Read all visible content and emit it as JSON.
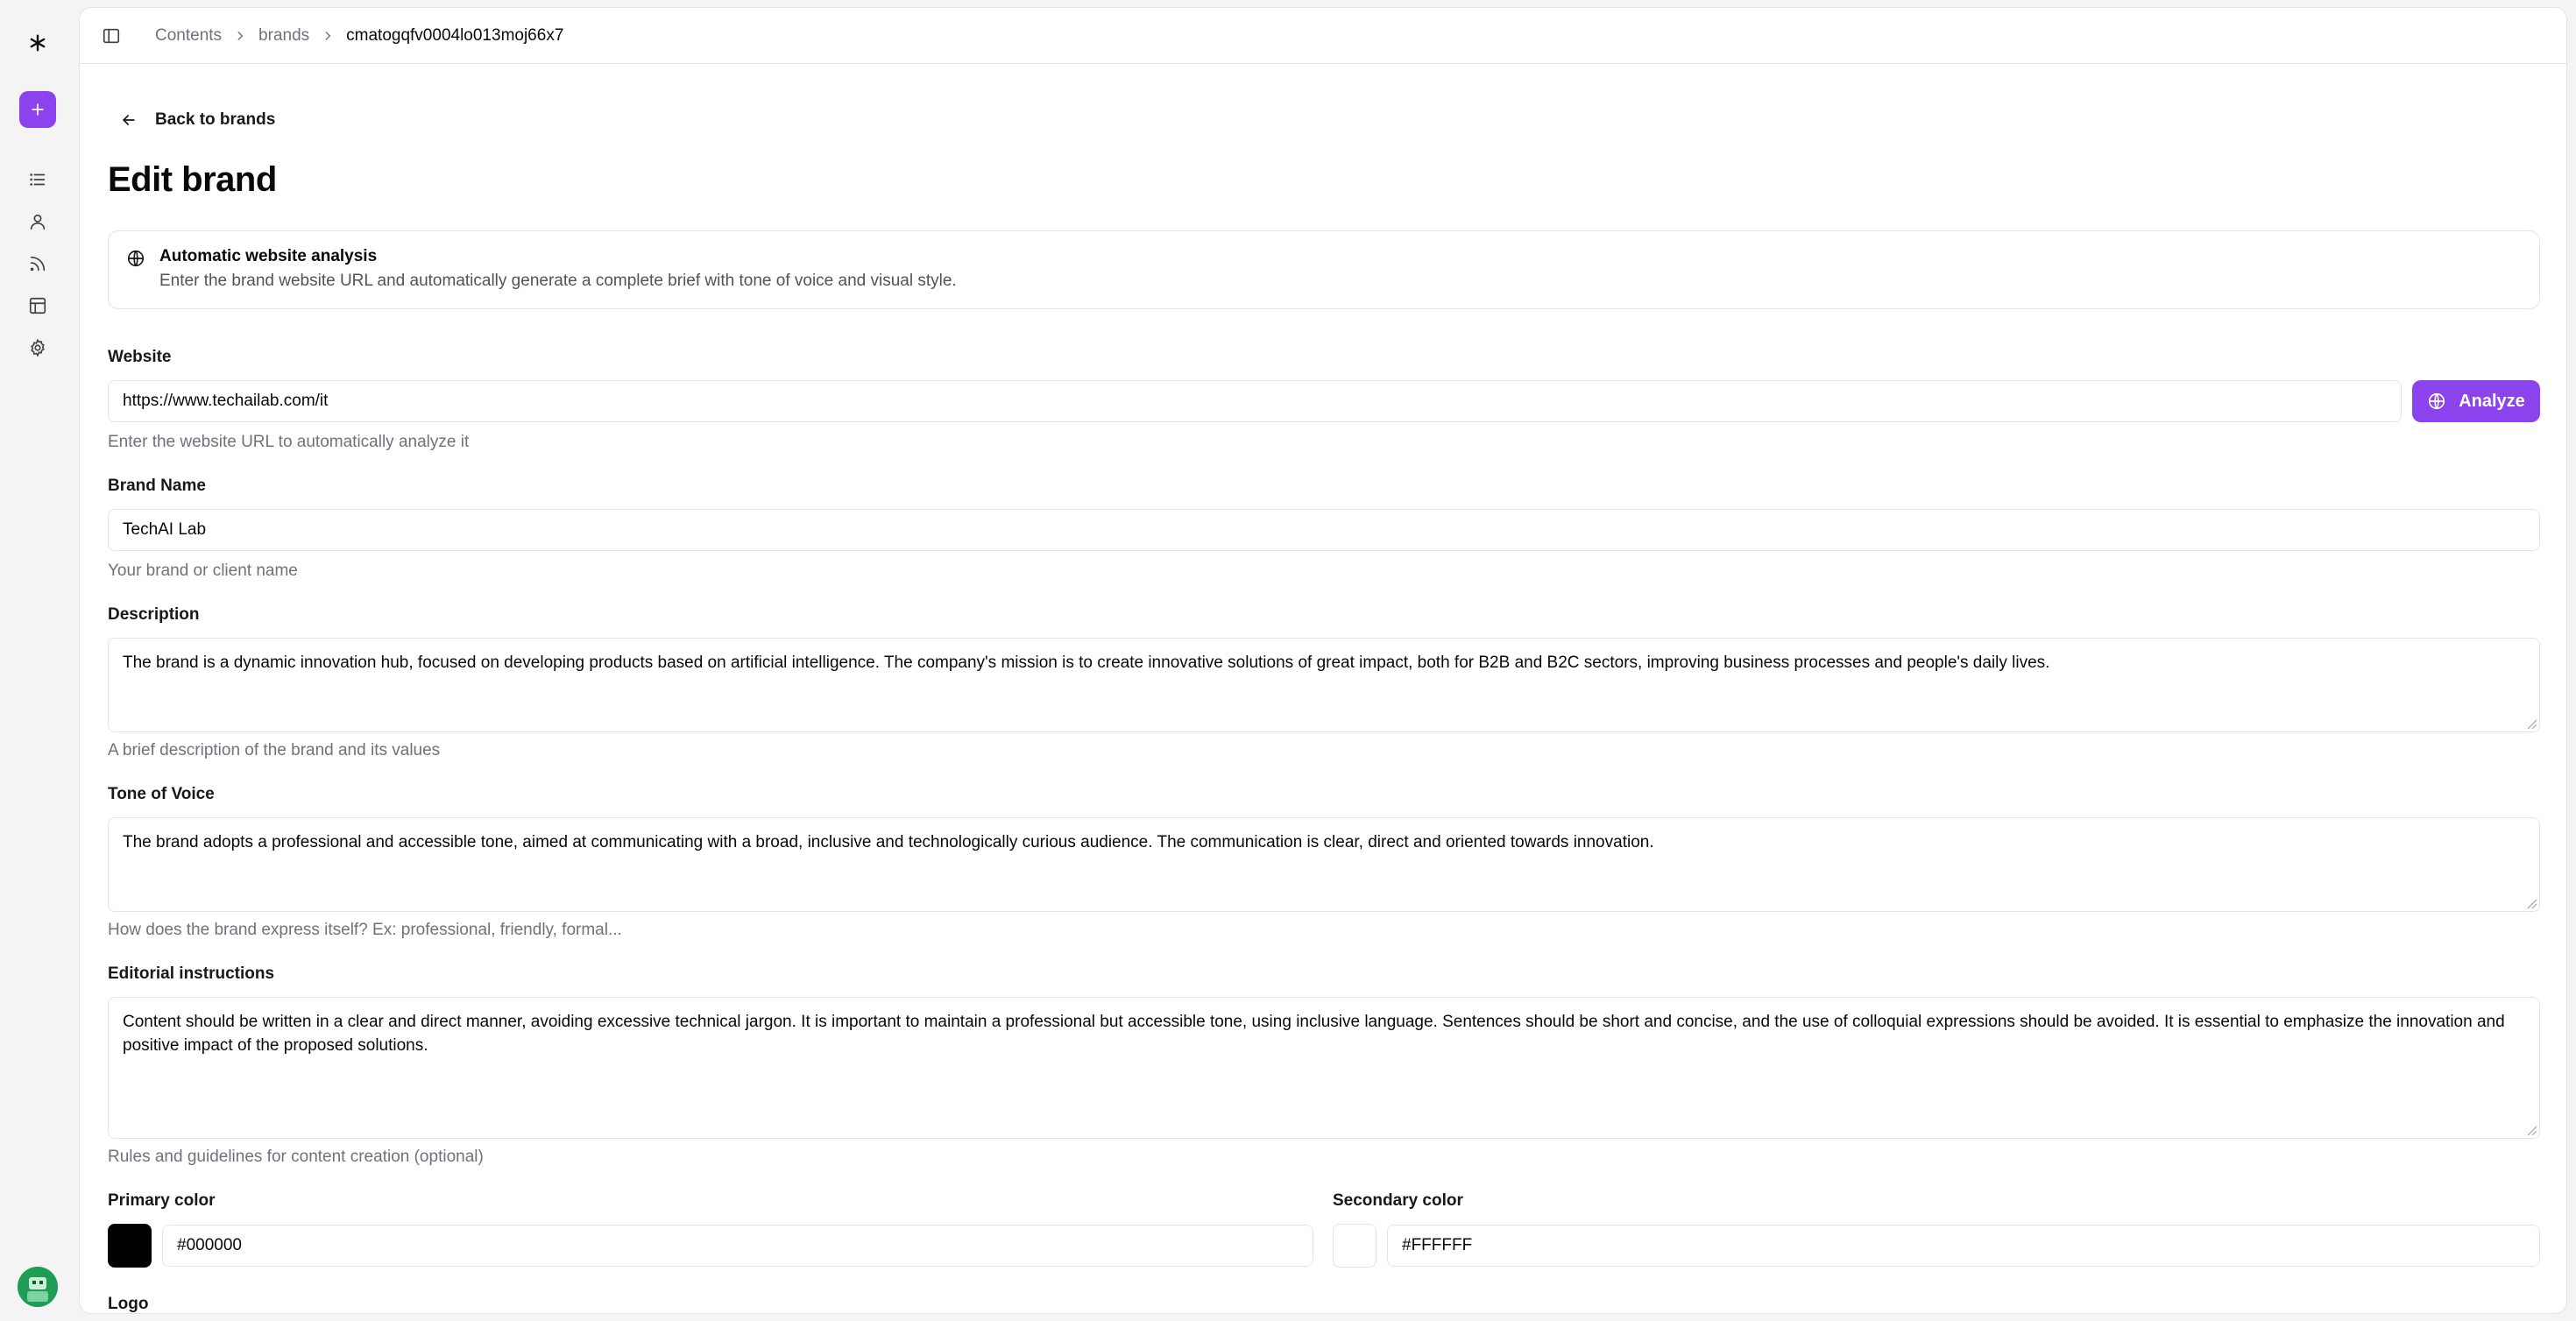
{
  "breadcrumb": {
    "items": [
      "Contents",
      "brands",
      "cmatogqfv0004lo013moj66x7"
    ]
  },
  "back_link": "Back to brands",
  "page_title": "Edit brand",
  "analysis_card": {
    "title": "Automatic website analysis",
    "description": "Enter the brand website URL and automatically generate a complete brief with tone of voice and visual style."
  },
  "website": {
    "label": "Website",
    "value": "https://www.techailab.com/it",
    "helper": "Enter the website URL to automatically analyze it",
    "analyze_button": "Analyze"
  },
  "brand_name": {
    "label": "Brand Name",
    "value": "TechAI Lab",
    "helper": "Your brand or client name"
  },
  "description": {
    "label": "Description",
    "value": "The brand is a dynamic innovation hub, focused on developing products based on artificial intelligence. The company's mission is to create innovative solutions of great impact, both for B2B and B2C sectors, improving business processes and people's daily lives.",
    "helper": "A brief description of the brand and its values"
  },
  "tone_of_voice": {
    "label": "Tone of Voice",
    "value": "The brand adopts a professional and accessible tone, aimed at communicating with a broad, inclusive and technologically curious audience. The communication is clear, direct and oriented towards innovation.",
    "helper": "How does the brand express itself? Ex: professional, friendly, formal..."
  },
  "editorial_instructions": {
    "label": "Editorial instructions",
    "value": "Content should be written in a clear and direct manner, avoiding excessive technical jargon. It is important to maintain a professional but accessible tone, using inclusive language. Sentences should be short and concise, and the use of colloquial expressions should be avoided. It is essential to emphasize the innovation and positive impact of the proposed solutions.",
    "helper": "Rules and guidelines for content creation (optional)"
  },
  "primary_color": {
    "label": "Primary color",
    "value": "#000000"
  },
  "secondary_color": {
    "label": "Secondary color",
    "value": "#FFFFFF"
  },
  "logo": {
    "label": "Logo"
  },
  "colors": {
    "accent": "#8b43ee",
    "border": "#e4e4e7",
    "muted_text": "#71717a"
  },
  "icons": {
    "app_logo": "asterisk-icon",
    "new": "plus-icon",
    "nav": [
      "list-icon",
      "user-icon",
      "rss-icon",
      "layout-icon",
      "settings-icon"
    ]
  }
}
